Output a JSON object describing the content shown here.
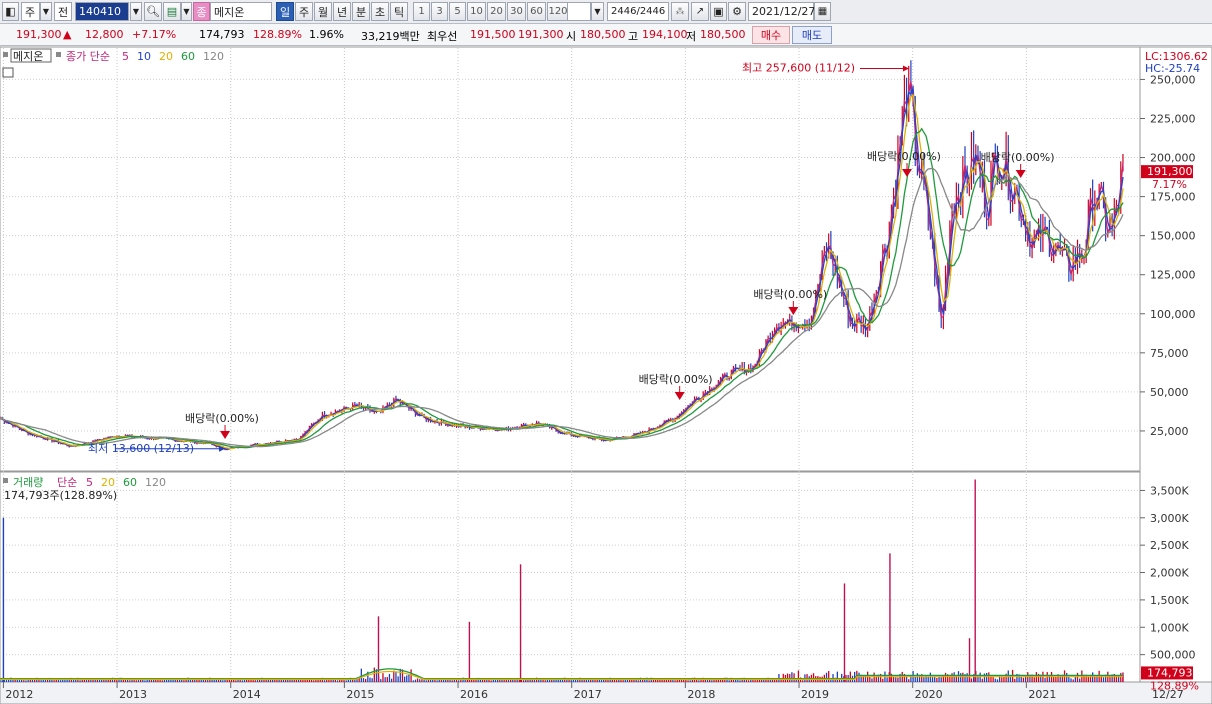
{
  "toolbar": {
    "market": "주",
    "scope": "전",
    "code": "140410",
    "stock_type_badge": "종",
    "stock_name": "메지온",
    "periods": [
      "일",
      "주",
      "월",
      "년",
      "분",
      "초",
      "틱"
    ],
    "active_period": "일",
    "intervals": [
      "1",
      "3",
      "5",
      "10",
      "20",
      "30",
      "60",
      "120"
    ],
    "count": "2446",
    "total": "/2446",
    "date": "2021/12/27"
  },
  "quote": {
    "price": "191,300",
    "change_arrow": "▲",
    "change": "12,800",
    "change_pct": "+7.17%",
    "volume": "174,793",
    "volume_ratio": "128.89%",
    "turnover": "1.96%",
    "amount": "33,219백만",
    "best_quote_label": "최우선",
    "ask": "191,500",
    "bid": "191,300",
    "open_label": "시",
    "open": "180,500",
    "high_label": "고",
    "high": "194,100",
    "low_label": "저",
    "low": "180,500",
    "buy_label": "매수",
    "sell_label": "매도"
  },
  "price_panel": {
    "name_tag": "메지온",
    "legend_prefix": "종가 단순",
    "ma_legend": [
      {
        "label": "5",
        "color": "#c0257a"
      },
      {
        "label": "10",
        "color": "#2244cc"
      },
      {
        "label": "20",
        "color": "#e0b000"
      },
      {
        "label": "60",
        "color": "#1e9a3c"
      },
      {
        "label": "120",
        "color": "#888888"
      }
    ],
    "lc": "LC:1306.62",
    "hc": "HC:-25.74",
    "last_price_label": "191,300",
    "last_change_label": "7.17%",
    "high_note": "최고 257,600 (11/12)",
    "low_note": "최저 13,600 (12/13)",
    "dividend_note": "배당락(0.00%)"
  },
  "volume_panel": {
    "legend_prefix": "거래량",
    "legend_method": "단순",
    "ma_legend": [
      {
        "label": "5",
        "color": "#c0257a"
      },
      {
        "label": "20",
        "color": "#e0b000"
      },
      {
        "label": "60",
        "color": "#1e9a3c"
      },
      {
        "label": "120",
        "color": "#888888"
      }
    ],
    "summary": "174,793주(128.89%)",
    "last_volume_label": "174,793",
    "last_ratio_label": "128.89%"
  },
  "x_axis_end_label": "12/27",
  "colors": {
    "up": "#d0021b",
    "down": "#1f3fbf",
    "ma5": "#c0257a",
    "ma10": "#2244cc",
    "ma20": "#e0b000",
    "ma60": "#1e9a3c",
    "ma120": "#888888"
  },
  "chart_data": [
    {
      "type": "line",
      "title": "",
      "x_ticks": [
        "2012",
        "2013",
        "2014",
        "2015",
        "2016",
        "2017",
        "2018",
        "2019",
        "2020",
        "2021"
      ],
      "y_ticks": [
        "25,000",
        "50,000",
        "75,000",
        "100,000",
        "125,000",
        "150,000",
        "175,000",
        "200,000",
        "225,000",
        "250,000"
      ],
      "ylim": [
        0,
        265000
      ],
      "series": [
        {
          "name": "종가",
          "x": [
            2011.9,
            2012.2,
            2012.6,
            2013.0,
            2013.4,
            2013.8,
            2013.95,
            2014.3,
            2014.6,
            2014.8,
            2015.1,
            2015.3,
            2015.45,
            2015.7,
            2016.0,
            2016.4,
            2016.7,
            2016.95,
            2017.3,
            2017.6,
            2017.9,
            2018.1,
            2018.4,
            2018.6,
            2018.8,
            2019.1,
            2019.25,
            2019.45,
            2019.6,
            2019.8,
            2019.95,
            2020.05,
            2020.15,
            2020.25,
            2020.35,
            2020.45,
            2020.55,
            2020.65,
            2020.75,
            2020.9,
            2021.05,
            2021.2,
            2021.35,
            2021.5,
            2021.6,
            2021.75,
            2021.85
          ],
          "values": [
            36000,
            24000,
            15000,
            22000,
            20000,
            17000,
            13600,
            17000,
            20000,
            35000,
            41000,
            36000,
            45000,
            33000,
            28000,
            26000,
            30000,
            23000,
            19000,
            23000,
            33000,
            46000,
            62000,
            66000,
            94000,
            95000,
            145000,
            95000,
            92000,
            160000,
            245000,
            195000,
            155000,
            90000,
            175000,
            185000,
            200000,
            170000,
            205000,
            180000,
            145000,
            150000,
            130000,
            140000,
            180000,
            150000,
            191300
          ]
        }
      ],
      "moving_averages": [
        "5",
        "10",
        "20",
        "60",
        "120"
      ],
      "annotations": [
        {
          "text": "최고 257,600 (11/12)",
          "x": 2019.95,
          "y": 257600
        },
        {
          "text": "최저 13,600 (12/13)",
          "x": 2013.95,
          "y": 13600
        },
        {
          "text": "배당락(0.00%)",
          "x": 2013.95
        },
        {
          "text": "배당락(0.00%)",
          "x": 2017.95
        },
        {
          "text": "배당락(0.00%)",
          "x": 2018.95
        },
        {
          "text": "배당락(0.00%)",
          "x": 2019.95
        },
        {
          "text": "배당락(0.00%)",
          "x": 2020.95
        }
      ]
    },
    {
      "type": "bar",
      "title": "",
      "y_ticks": [
        "500,000",
        "1,000K",
        "1,500K",
        "2,000K",
        "2,500K",
        "3,000K",
        "3,500K"
      ],
      "ylim": [
        0,
        3800000
      ],
      "spikes": [
        {
          "x": 2012.0,
          "value": 3000000
        },
        {
          "x": 2015.3,
          "value": 1200000
        },
        {
          "x": 2016.1,
          "value": 1100000
        },
        {
          "x": 2016.55,
          "value": 2150000
        },
        {
          "x": 2019.4,
          "value": 1800000
        },
        {
          "x": 2019.8,
          "value": 2350000
        },
        {
          "x": 2020.55,
          "value": 3700000
        },
        {
          "x": 2020.5,
          "value": 800000
        },
        {
          "x": 2021.85,
          "value": 174793
        }
      ]
    }
  ]
}
